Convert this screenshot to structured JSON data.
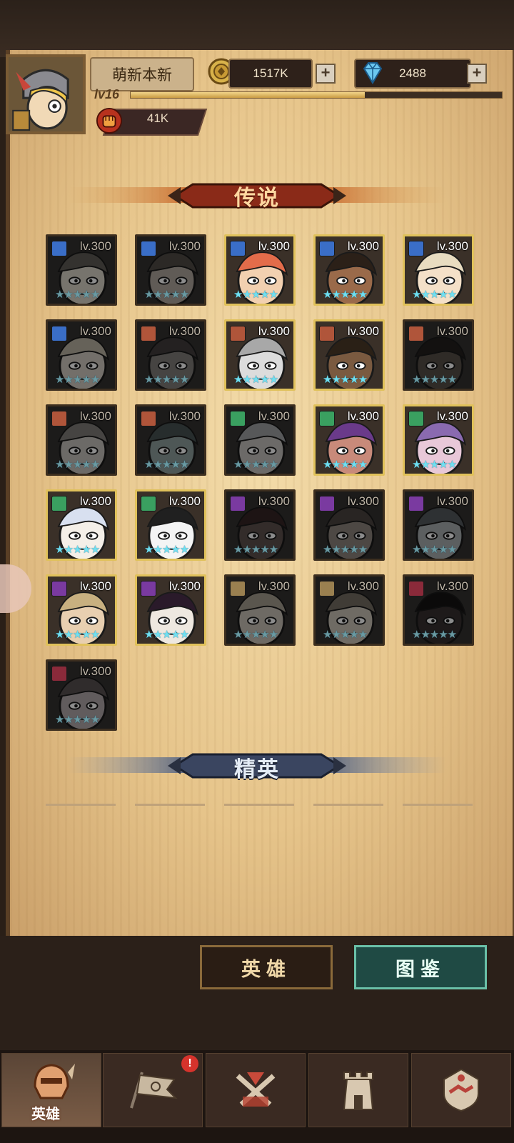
{
  "player": {
    "name": "萌新本新",
    "level_label": "lv16",
    "xp_progress": 0.63,
    "power": "41K"
  },
  "currency": {
    "gold": "1517K",
    "diamonds": "2488",
    "gold_icon": "gold-coin-icon",
    "diamond_icon": "diamond-icon"
  },
  "sections": {
    "legend": "传说",
    "elite": "精英"
  },
  "heroes": [
    {
      "level": "lv.300",
      "owned": false,
      "element": "#3a6ec7",
      "skin": "#e9d1a3",
      "hair": "#6a5a40"
    },
    {
      "level": "lv.300",
      "owned": false,
      "element": "#3a6ec7",
      "skin": "#c8a27a",
      "hair": "#5a4a30"
    },
    {
      "level": "lv.300",
      "owned": true,
      "element": "#3a6ec7",
      "skin": "#f2d0b0",
      "hair": "#e36c4a"
    },
    {
      "level": "lv.300",
      "owned": true,
      "element": "#3a6ec7",
      "skin": "#9a6a4a",
      "hair": "#2b2018"
    },
    {
      "level": "lv.300",
      "owned": true,
      "element": "#3a6ec7",
      "skin": "#f4e0c8",
      "hair": "#e8dcc0"
    },
    {
      "level": "lv.300",
      "owned": false,
      "element": "#3a6ec7",
      "skin": "#e2c8a0",
      "hair": "#d0b070"
    },
    {
      "level": "lv.300",
      "owned": false,
      "element": "#b0553a",
      "skin": "#8a7a6a",
      "hair": "#4a3a3a"
    },
    {
      "level": "lv.300",
      "owned": true,
      "element": "#b0553a",
      "skin": "#dcdcdc",
      "hair": "#a8a8a8"
    },
    {
      "level": "lv.300",
      "owned": true,
      "element": "#b0553a",
      "skin": "#7a5a40",
      "hair": "#2a2016"
    },
    {
      "level": "lv.300",
      "owned": false,
      "element": "#b0553a",
      "skin": "#6a4a30",
      "hair": "#2a1e16"
    },
    {
      "level": "lv.300",
      "owned": false,
      "element": "#b0553a",
      "skin": "#cdbfae",
      "hair": "#8a7a6a"
    },
    {
      "level": "lv.300",
      "owned": false,
      "element": "#b0553a",
      "skin": "#6aa8a0",
      "hair": "#2a5a5a"
    },
    {
      "level": "lv.300",
      "owned": false,
      "element": "#3aa060",
      "skin": "#cdc0b0",
      "hair": "#9aa0a8"
    },
    {
      "level": "lv.300",
      "owned": true,
      "element": "#3aa060",
      "skin": "#c88a7a",
      "hair": "#6a3a8a"
    },
    {
      "level": "lv.300",
      "owned": true,
      "element": "#3aa060",
      "skin": "#e8c8d8",
      "hair": "#8a6ab0"
    },
    {
      "level": "lv.300",
      "owned": true,
      "element": "#3aa060",
      "skin": "#f4efe8",
      "hair": "#d8e0f0"
    },
    {
      "level": "lv.300",
      "owned": true,
      "element": "#3aa060",
      "skin": "#f4f4f4",
      "hair": "#202020"
    },
    {
      "level": "lv.300",
      "owned": false,
      "element": "#7a3aa0",
      "skin": "#7a4a3a",
      "hair": "#5a1a1a"
    },
    {
      "level": "lv.300",
      "owned": false,
      "element": "#7a3aa0",
      "skin": "#a08060",
      "hair": "#5a4030"
    },
    {
      "level": "lv.300",
      "owned": false,
      "element": "#7a3aa0",
      "skin": "#9ab0b8",
      "hair": "#4a5a6a"
    },
    {
      "level": "lv.300",
      "owned": true,
      "element": "#7a3aa0",
      "skin": "#e8cfb0",
      "hair": "#c8b080"
    },
    {
      "level": "lv.300",
      "owned": true,
      "element": "#7a3aa0",
      "skin": "#eee8e0",
      "hair": "#2a1a2a"
    },
    {
      "level": "lv.300",
      "owned": false,
      "element": "#9a8050",
      "skin": "#d8c090",
      "hair": "#b89a60"
    },
    {
      "level": "lv.300",
      "owned": false,
      "element": "#9a8050",
      "skin": "#e0c090",
      "hair": "#8a6a40"
    },
    {
      "level": "lv.300",
      "owned": false,
      "element": "#8a2a3a",
      "skin": "#4a2a2a",
      "hair": "#1a1010"
    },
    {
      "level": "lv.300",
      "owned": false,
      "element": "#8a2a3a",
      "skin": "#c8a0a8",
      "hair": "#6a4a4a"
    }
  ],
  "buttons": {
    "heroes": "英雄",
    "codex": "图鉴"
  },
  "nav": {
    "active_label": "英雄",
    "badge": "!",
    "items": [
      "hero-helmet-icon",
      "adventure-flag-icon",
      "battle-swords-icon",
      "castle-tower-icon",
      "alliance-handshake-icon"
    ]
  }
}
